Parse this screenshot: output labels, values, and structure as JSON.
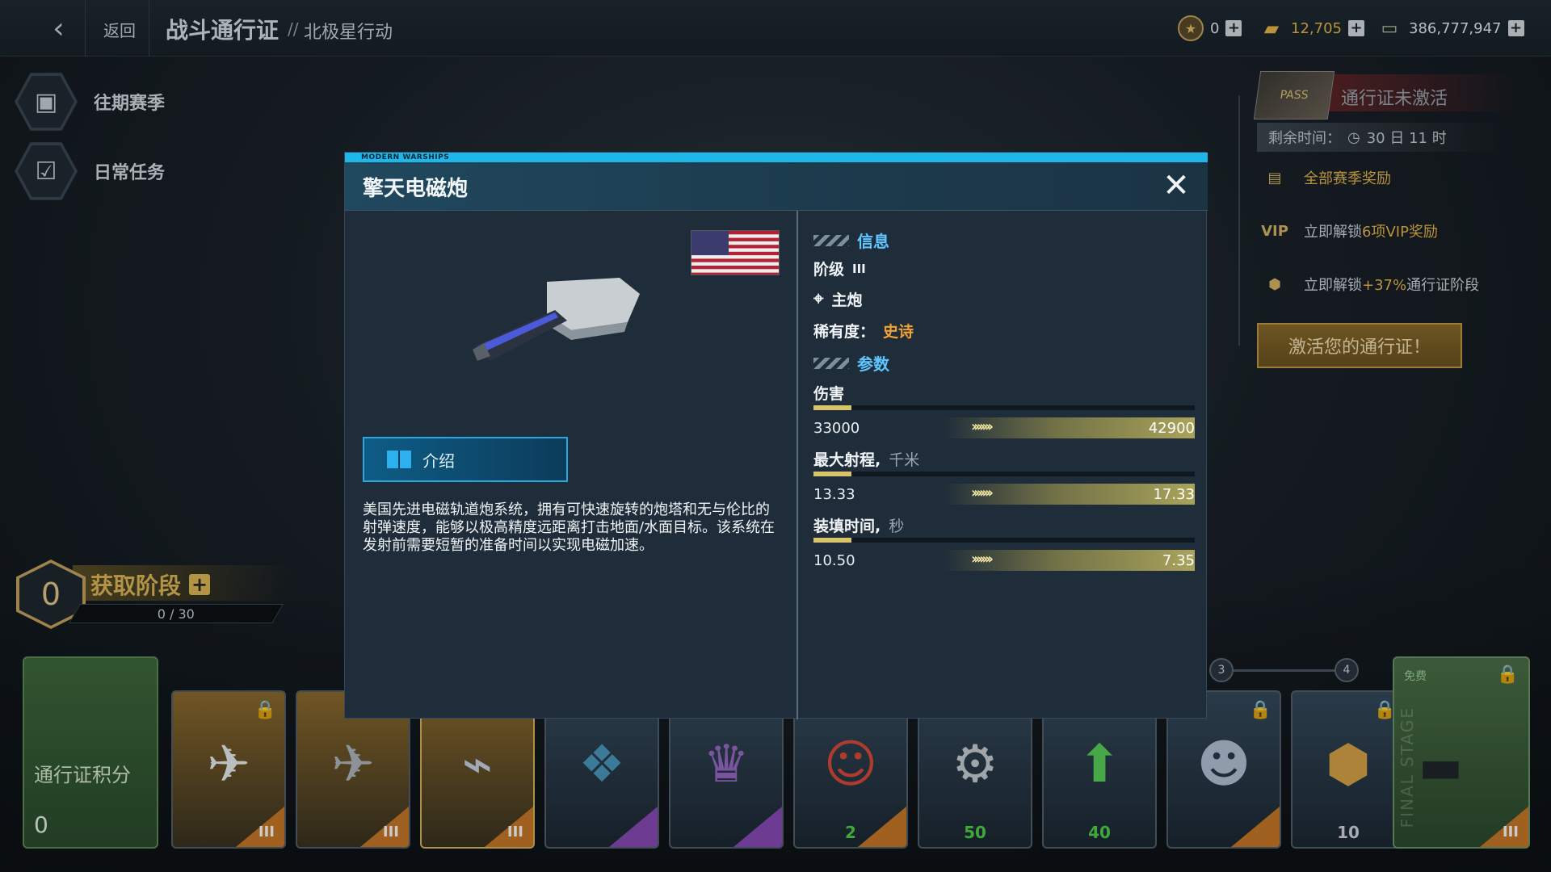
{
  "topbar": {
    "back_label": "返回",
    "title": "战斗通行证",
    "separator": "//",
    "subtitle": "北极星行动",
    "currencies": [
      {
        "name": "medal-icon",
        "value": "0",
        "color": "#e8c06a"
      },
      {
        "name": "gold-bar-icon",
        "value": "12,705",
        "color": "#e7b84b"
      },
      {
        "name": "cash-icon",
        "value": "386,777,947",
        "color": "#d9dee2"
      }
    ]
  },
  "sidebar": {
    "items": [
      {
        "label": "往期赛季",
        "icon": "past-season-icon"
      },
      {
        "label": "日常任务",
        "icon": "daily-tasks-icon"
      }
    ]
  },
  "pass_panel": {
    "status": "通行证未激活",
    "remaining_label": "剩余时间：",
    "remaining_value": "30 日 11 时",
    "all_rewards": "全部赛季奖励",
    "vip_prefix": "立即解锁",
    "vip_highlight": "6项VIP奖励",
    "boost_prefix": "立即解锁",
    "boost_highlight": "+37%",
    "boost_suffix": "通行证阶段",
    "activate_button": "激活您的通行证！"
  },
  "stage": {
    "level": "0",
    "title": "获取阶段",
    "progress": "0 / 30"
  },
  "track": {
    "points_label": "通行证积分",
    "points_value": "0",
    "nodes": [
      "3",
      "4"
    ],
    "free_label": "免费",
    "final_label": "FINAL STAGE",
    "cards": [
      {
        "tier": "III",
        "locked": true
      },
      {
        "tier": "III",
        "locked": false
      },
      {
        "tier": "III",
        "locked": false
      },
      {
        "tier": "",
        "locked": false
      },
      {
        "tier": "",
        "locked": false
      },
      {
        "count": "2"
      },
      {
        "count": "50"
      },
      {
        "count": "40"
      },
      {
        "tier": "",
        "locked": true
      },
      {
        "count": "10",
        "locked": true
      },
      {
        "tier": "III",
        "locked": true
      }
    ]
  },
  "modal": {
    "brand": "MODERN WARSHIPS",
    "title": "擎天电磁炮",
    "close_icon": "close-icon",
    "intro_button": "介绍",
    "description": "美国先进电磁轨道炮系统，拥有可快速旋转的炮塔和无与伦比的射弹速度，能够以极高精度远距离打击地面/水面目标。该系统在发射前需要短暂的准备时间以实现电磁加速。",
    "info_header": "信息",
    "tier_label": "阶级",
    "tier_value": "III",
    "type_label": "主炮",
    "rarity_label": "稀有度：",
    "rarity_value": "史诗",
    "params_header": "参数",
    "stats": [
      {
        "label": "伤害",
        "unit": "",
        "base": "33000",
        "max": "42900",
        "fill": 0.1
      },
      {
        "label": "最大射程,",
        "unit": "千米",
        "base": "13.33",
        "max": "17.33",
        "fill": 0.1
      },
      {
        "label": "装填时间,",
        "unit": "秒",
        "base": "10.50",
        "max": "7.35",
        "fill": 0.1
      }
    ]
  }
}
